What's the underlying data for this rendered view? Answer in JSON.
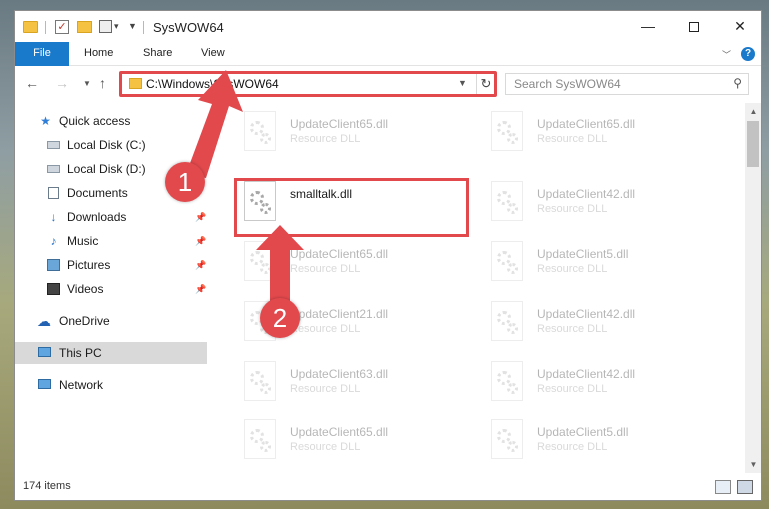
{
  "title": "SysWOW64",
  "ribbon": {
    "file": "File",
    "home": "Home",
    "share": "Share",
    "view": "View",
    "help": "?"
  },
  "address": {
    "path": "C:\\Windows\\SysWOW64"
  },
  "search": {
    "placeholder": "Search SysWOW64"
  },
  "sidebar": {
    "items": [
      {
        "label": "Quick access"
      },
      {
        "label": "Local Disk (C:)"
      },
      {
        "label": "Local Disk (D:)"
      },
      {
        "label": "Documents"
      },
      {
        "label": "Downloads"
      },
      {
        "label": "Music"
      },
      {
        "label": "Pictures"
      },
      {
        "label": "Videos"
      },
      {
        "label": "OneDrive"
      },
      {
        "label": "This PC"
      },
      {
        "label": "Network"
      }
    ]
  },
  "files": {
    "left": [
      {
        "name": "UpdateClient65.dll",
        "type": "Resource DLL"
      },
      {
        "name": "smalltalk.dll",
        "type": ""
      },
      {
        "name": "UpdateClient65.dll",
        "type": "Resource DLL"
      },
      {
        "name": "UpdateClient21.dll",
        "type": "Resource DLL"
      },
      {
        "name": "UpdateClient63.dll",
        "type": "Resource DLL"
      },
      {
        "name": "UpdateClient65.dll",
        "type": "Resource DLL"
      }
    ],
    "right": [
      {
        "name": "UpdateClient65.dll",
        "type": "Resource DLL"
      },
      {
        "name": "UpdateClient42.dll",
        "type": "Resource DLL"
      },
      {
        "name": "UpdateClient5.dll",
        "type": "Resource DLL"
      },
      {
        "name": "UpdateClient42.dll",
        "type": "Resource DLL"
      },
      {
        "name": "UpdateClient42.dll",
        "type": "Resource DLL"
      },
      {
        "name": "UpdateClient5.dll",
        "type": "Resource DLL"
      }
    ]
  },
  "status": {
    "count": "174 items"
  },
  "callouts": {
    "one": "1",
    "two": "2"
  },
  "colors": {
    "accent": "#1979ca",
    "highlight": "#e2494d"
  }
}
